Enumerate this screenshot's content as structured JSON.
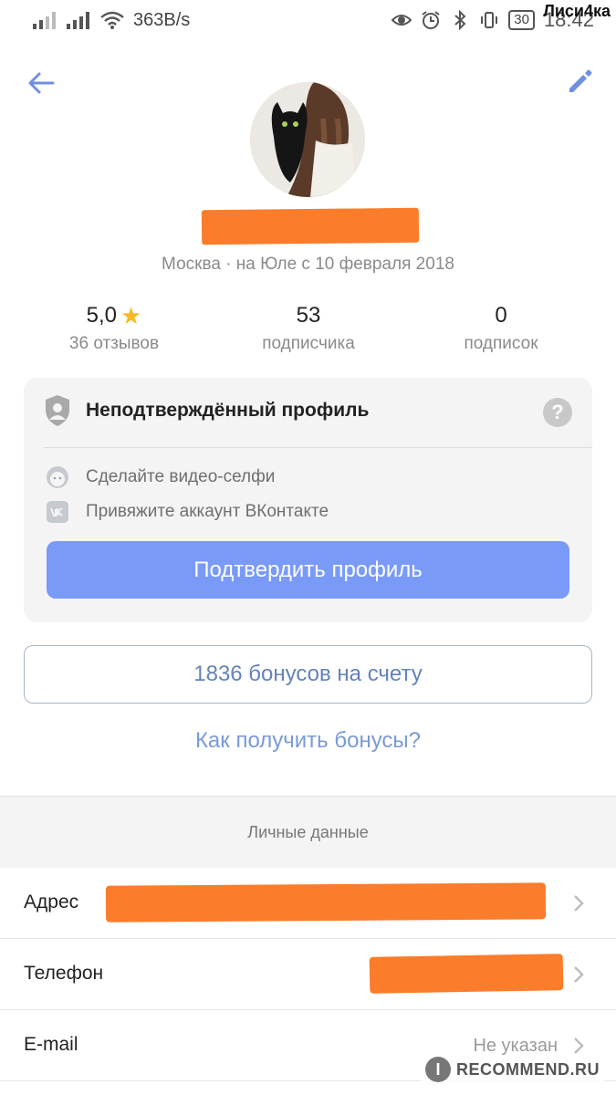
{
  "statusbar": {
    "speed": "363B/s",
    "battery": "30",
    "time": "18:42",
    "watermark_user": "Лиси4ка"
  },
  "profile": {
    "meta": "Москва · на Юле с 10 февраля 2018"
  },
  "stats": [
    {
      "value": "5,0",
      "label": "36 отзывов"
    },
    {
      "value": "53",
      "label": "подписчика"
    },
    {
      "value": "0",
      "label": "подписок"
    }
  ],
  "verify": {
    "title": "Неподтверждённый профиль",
    "help": "?",
    "items": [
      {
        "label": "Сделайте видео-селфи"
      },
      {
        "label": "Привяжите аккаунт ВКонтакте"
      }
    ],
    "button": "Подтвердить профиль"
  },
  "bonus": {
    "balance_button": "1836 бонусов на счету",
    "how_link": "Как получить бонусы?"
  },
  "personal": {
    "section_title": "Личные данные",
    "rows": [
      {
        "label": "Адрес",
        "value": ""
      },
      {
        "label": "Телефон",
        "value": ""
      },
      {
        "label": "E-mail",
        "value": "Не указан"
      }
    ]
  },
  "watermark": {
    "badge": "I",
    "text": "RECOMMEND.RU"
  },
  "colors": {
    "accent": "#7a9af8",
    "link": "#7a9ad8",
    "redaction": "#fb7c2a",
    "star": "#f5b923"
  }
}
